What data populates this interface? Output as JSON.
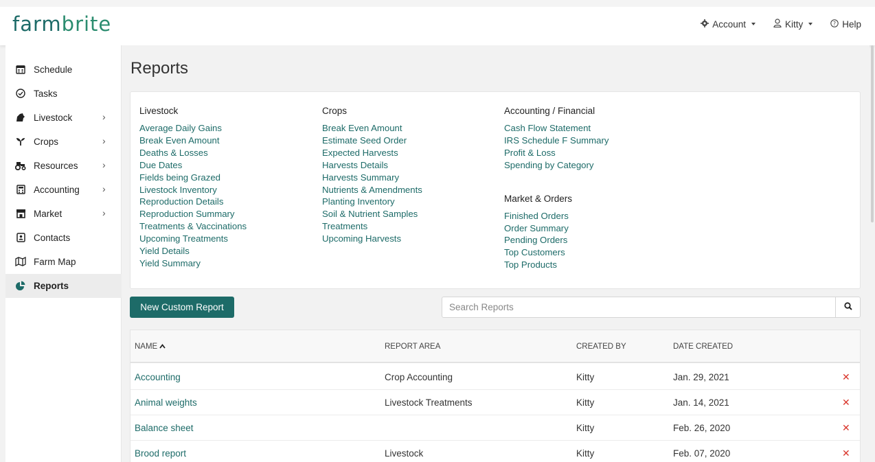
{
  "brand": {
    "logo_text_1": "farm",
    "logo_text_2": "brite"
  },
  "topnav": {
    "account_label": "Account",
    "user_label": "Kitty",
    "help_label": "Help"
  },
  "sidebar": {
    "items": [
      {
        "label": "Schedule",
        "icon": "calendar-icon",
        "has_chevron": false
      },
      {
        "label": "Tasks",
        "icon": "check-circle-icon",
        "has_chevron": false
      },
      {
        "label": "Livestock",
        "icon": "livestock-icon",
        "has_chevron": true
      },
      {
        "label": "Crops",
        "icon": "sprout-icon",
        "has_chevron": true
      },
      {
        "label": "Resources",
        "icon": "tractor-icon",
        "has_chevron": true
      },
      {
        "label": "Accounting",
        "icon": "calculator-icon",
        "has_chevron": true
      },
      {
        "label": "Market",
        "icon": "store-icon",
        "has_chevron": true
      },
      {
        "label": "Contacts",
        "icon": "contact-icon",
        "has_chevron": false
      },
      {
        "label": "Farm Map",
        "icon": "map-icon",
        "has_chevron": false
      },
      {
        "label": "Reports",
        "icon": "pie-chart-icon",
        "has_chevron": false,
        "active": true
      }
    ]
  },
  "page": {
    "title": "Reports"
  },
  "categories": {
    "livestock": {
      "heading": "Livestock",
      "links": [
        "Average Daily Gains",
        "Break Even Amount",
        "Deaths & Losses",
        "Due Dates",
        "Fields being Grazed",
        "Livestock Inventory",
        "Reproduction Details",
        "Reproduction Summary",
        "Treatments & Vaccinations",
        "Upcoming Treatments",
        "Yield Details",
        "Yield Summary"
      ]
    },
    "crops": {
      "heading": "Crops",
      "links": [
        "Break Even Amount",
        "Estimate Seed Order",
        "Expected Harvests",
        "Harvests Details",
        "Harvests Summary",
        "Nutrients & Amendments",
        "Planting Inventory",
        "Soil & Nutrient Samples",
        "Treatments",
        "Upcoming Harvests"
      ]
    },
    "accounting": {
      "heading": "Accounting / Financial",
      "links": [
        "Cash Flow Statement",
        "IRS Schedule F Summary",
        "Profit & Loss",
        "Spending by Category"
      ]
    },
    "market": {
      "heading": "Market & Orders",
      "links": [
        "Finished Orders",
        "Order Summary",
        "Pending Orders",
        "Top Customers",
        "Top Products"
      ]
    }
  },
  "actions": {
    "new_custom_report": "New Custom Report"
  },
  "search": {
    "placeholder": "Search Reports",
    "value": ""
  },
  "table": {
    "columns": [
      "NAME",
      "REPORT AREA",
      "CREATED BY",
      "DATE CREATED"
    ],
    "sort_column": "NAME",
    "sort_direction": "ascending",
    "rows": [
      {
        "name": "Accounting",
        "area": "Crop Accounting",
        "created_by": "Kitty",
        "date": "Jan. 29, 2021",
        "delete": "✕"
      },
      {
        "name": "Animal weights",
        "area": "Livestock Treatments",
        "created_by": "Kitty",
        "date": "Jan. 14, 2021",
        "delete": "✕"
      },
      {
        "name": "Balance sheet",
        "area": "",
        "created_by": "Kitty",
        "date": "Feb. 26, 2020",
        "delete": "✕"
      },
      {
        "name": "Brood report",
        "area": "Livestock",
        "created_by": "Kitty",
        "date": "Feb. 07, 2020",
        "delete": "✕"
      }
    ]
  },
  "colors": {
    "brand_teal": "#1d6b68",
    "delete_red": "#d9352b"
  }
}
